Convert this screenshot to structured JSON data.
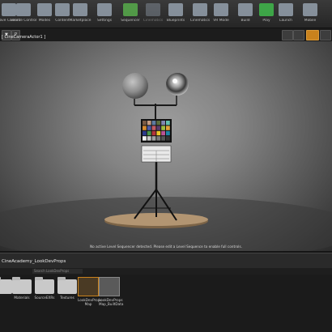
{
  "toolbar": {
    "items": [
      {
        "label": "Save Current",
        "icon": "save-icon"
      },
      {
        "label": "Source Control",
        "icon": "source-control-icon"
      },
      {
        "label": "Modes",
        "icon": "modes-icon"
      },
      {
        "label": "Content",
        "icon": "content-icon"
      },
      {
        "label": "Marketplace",
        "icon": "marketplace-icon"
      },
      {
        "label": "Settings",
        "icon": "settings-icon"
      },
      {
        "label": "Sequencer",
        "icon": "sequencer-icon"
      },
      {
        "label": "Cinematics",
        "icon": "cinematics-icon"
      },
      {
        "label": "Blueprints",
        "icon": "blueprints-icon"
      },
      {
        "label": "Cinematics",
        "icon": "cinematics-icon-2"
      },
      {
        "label": "VR Mode",
        "icon": "vr-mode-icon"
      },
      {
        "label": "Build",
        "icon": "build-icon"
      },
      {
        "label": "Play",
        "icon": "play-icon"
      },
      {
        "label": "Launch",
        "icon": "launch-icon"
      },
      {
        "label": "Mobile",
        "icon": "mobile-icon"
      }
    ]
  },
  "viewport": {
    "pilot_label": "[ CineCameraActor1 ]",
    "message": "No active Level Sequencer detected. Please edit a Level Sequence to enable full controls."
  },
  "content_browser": {
    "title": "CineAcademy_LookDevProps",
    "path_placeholder": "Search LookDevProps",
    "assets": [
      {
        "label": "",
        "type": "folder"
      },
      {
        "label": "Materials",
        "type": "folder"
      },
      {
        "label": "SourceEXRs",
        "type": "folder"
      },
      {
        "label": "Textures",
        "type": "folder"
      },
      {
        "label": "LookDevProps Map",
        "type": "map"
      },
      {
        "label": "LookDevProps Map_BuiltData",
        "type": "builtdata"
      }
    ]
  },
  "colors": {
    "accent_orange": "#c9821d",
    "folder_grey": "#c9c9c9",
    "play_green": "#3fb24a"
  }
}
